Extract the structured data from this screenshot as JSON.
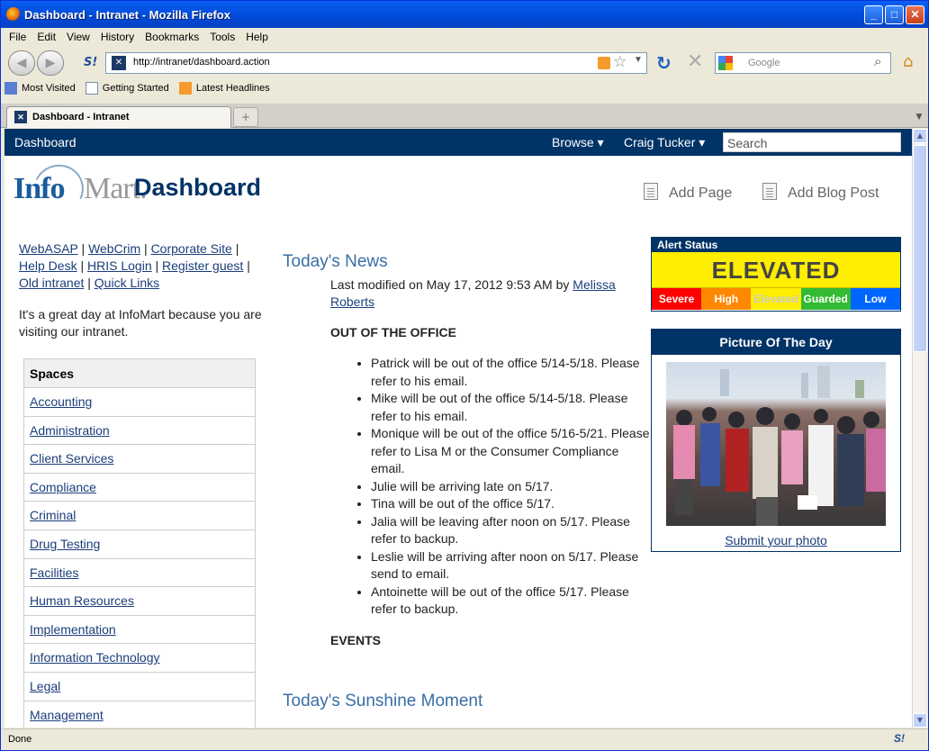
{
  "window": {
    "title": "Dashboard - Intranet - Mozilla Firefox"
  },
  "menu": [
    "File",
    "Edit",
    "View",
    "History",
    "Bookmarks",
    "Tools",
    "Help"
  ],
  "nav": {
    "url": "http://intranet/dashboard.action",
    "search_placeholder": "Google"
  },
  "bookmarks": [
    "Most Visited",
    "Getting Started",
    "Latest Headlines"
  ],
  "tab": {
    "label": "Dashboard - Intranet"
  },
  "status": "Done",
  "page": {
    "topnav": {
      "home": "Dashboard",
      "browse": "Browse",
      "user": "Craig Tucker",
      "search_placeholder": "Search"
    },
    "logo": {
      "info": "Info",
      "mart": "Mart."
    },
    "title": "Dashboard",
    "actions": {
      "add_page": "Add Page",
      "add_blog": "Add Blog Post"
    },
    "links": [
      "WebASAP",
      "WebCrim",
      "Corporate Site",
      "Help Desk",
      "HRIS Login",
      "Register guest",
      "Old intranet",
      "Quick Links"
    ],
    "greeting": "It's a great day at InfoMart because you are visiting our intranet.",
    "spaces": {
      "header": "Spaces",
      "items": [
        "Accounting",
        "Administration",
        "Client Services",
        "Compliance",
        "Criminal",
        "Drug Testing",
        "Facilities",
        "Human Resources",
        "Implementation",
        "Information Technology",
        "Legal",
        "Management"
      ]
    },
    "news": {
      "title": "Today's News",
      "modified": "Last modified on May 17, 2012 9:53 AM by",
      "author": "Melissa Roberts",
      "section": "OUT OF THE OFFICE",
      "items": [
        "Patrick will be out of the office 5/14-5/18. Please refer to his email.",
        "Mike will be out of the office 5/14-5/18. Please refer to his email.",
        "Monique will be out of the office 5/16-5/21. Please refer to Lisa M or the Consumer Compliance email.",
        "Julie will be arriving late on 5/17.",
        "Tina will be out of the office 5/17.",
        "Jalia will be leaving after noon on 5/17. Please refer to backup.",
        "Leslie will be arriving after noon on 5/17. Please send to email.",
        "Antoinette will be out of the office 5/17. Please refer to backup."
      ],
      "events": "EVENTS"
    },
    "sunshine": "Today's Sunshine Moment",
    "alert": {
      "title": "Alert Status",
      "level": "ELEVATED",
      "levels": [
        {
          "label": "Severe",
          "color": "#ff0000"
        },
        {
          "label": "High",
          "color": "#ff8800"
        },
        {
          "label": "Elevated",
          "color": "#ffee00"
        },
        {
          "label": "Guarded",
          "color": "#33bb33"
        },
        {
          "label": "Low",
          "color": "#0066ff"
        }
      ]
    },
    "potd": {
      "title": "Picture Of The Day",
      "submit": "Submit your photo"
    }
  }
}
